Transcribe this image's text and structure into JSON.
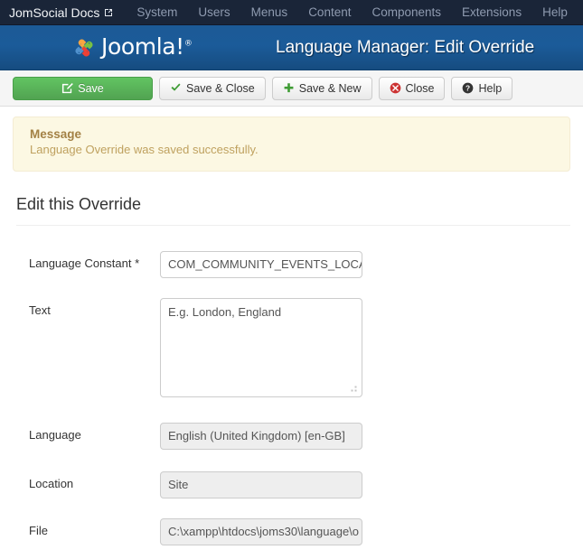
{
  "topnav": {
    "brand": "JomSocial Docs",
    "brand_icon": "external-link-icon",
    "items": [
      {
        "label": "System"
      },
      {
        "label": "Users"
      },
      {
        "label": "Menus"
      },
      {
        "label": "Content"
      },
      {
        "label": "Components"
      },
      {
        "label": "Extensions"
      },
      {
        "label": "Help"
      }
    ]
  },
  "header": {
    "logo_text": "Joomla!",
    "logo_trademark": "®",
    "logo_icon": "joomla-logo-icon",
    "title": "Language Manager: Edit Override"
  },
  "toolbar": {
    "buttons": [
      {
        "label": "Save",
        "icon": "edit-pencil-icon",
        "style": "primary"
      },
      {
        "label": "Save & Close",
        "icon": "check-icon",
        "style": "default"
      },
      {
        "label": "Save & New",
        "icon": "plus-icon",
        "style": "default"
      },
      {
        "label": "Close",
        "icon": "close-circle-icon",
        "style": "default"
      },
      {
        "label": "Help",
        "icon": "help-circle-icon",
        "style": "default"
      }
    ]
  },
  "alert": {
    "title": "Message",
    "text": "Language Override was saved successfully.",
    "background_color": "#fcf8e3",
    "title_color": "#a38145",
    "text_color": "#bfa15f"
  },
  "form": {
    "section_title": "Edit this Override",
    "fields": {
      "language_constant": {
        "label": "Language Constant *",
        "value": "COM_COMMUNITY_EVENTS_LOCA"
      },
      "text": {
        "label": "Text",
        "value": "E.g. London, England"
      },
      "language": {
        "label": "Language",
        "value": "English (United Kingdom) [en-GB]"
      },
      "location": {
        "label": "Location",
        "value": "Site"
      },
      "file": {
        "label": "File",
        "value": "C:\\xampp\\htdocs\\joms30\\language\\o"
      }
    }
  },
  "colors": {
    "topnav_bg": "#1a2538",
    "header_blue": "#1b5a95",
    "save_green": "#51a351",
    "close_red": "#cc3333"
  }
}
